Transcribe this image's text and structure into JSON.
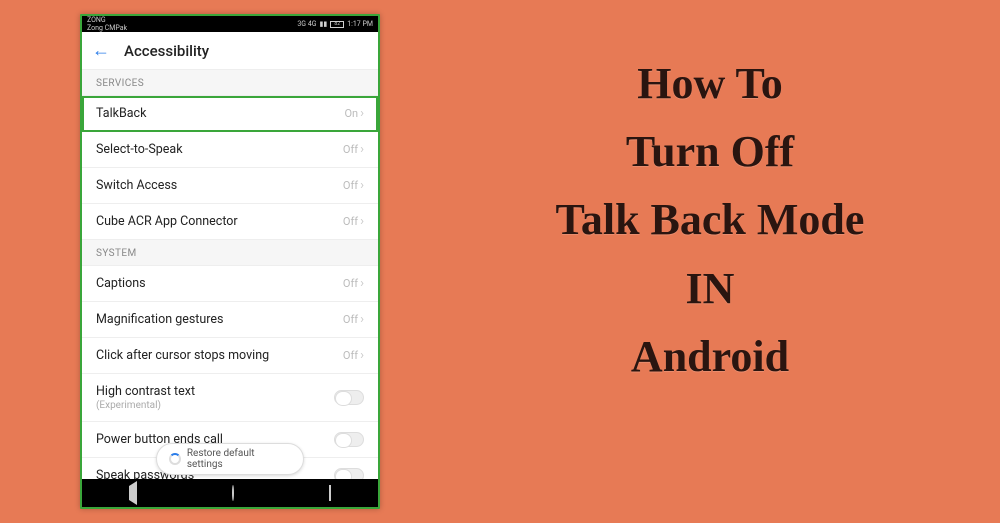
{
  "statusbar": {
    "carrier": "ZONG",
    "sub_carrier": "Zong CMPak",
    "network": "3G 4G",
    "battery": "82",
    "time": "1:17 PM"
  },
  "header": {
    "title": "Accessibility"
  },
  "sections": {
    "services_label": "SERVICES",
    "system_label": "SYSTEM"
  },
  "rows": {
    "talkback": {
      "label": "TalkBack",
      "value": "On"
    },
    "select_to_speak": {
      "label": "Select-to-Speak",
      "value": "Off"
    },
    "switch_access": {
      "label": "Switch Access",
      "value": "Off"
    },
    "cube_acr": {
      "label": "Cube ACR App Connector",
      "value": "Off"
    },
    "captions": {
      "label": "Captions",
      "value": "Off"
    },
    "magnification": {
      "label": "Magnification gestures",
      "value": "Off"
    },
    "click_cursor": {
      "label": "Click after cursor stops moving",
      "value": "Off"
    },
    "high_contrast": {
      "label": "High contrast text",
      "sub": "(Experimental)"
    },
    "power_ends_call": {
      "label": "Power button ends call"
    },
    "speak_passwords": {
      "label": "Speak passwords"
    }
  },
  "toast": {
    "text": "Restore default settings"
  },
  "headline": {
    "line1": "How To",
    "line2": "Turn Off",
    "line3": "Talk Back Mode",
    "line4": "IN",
    "line5": "Android"
  }
}
